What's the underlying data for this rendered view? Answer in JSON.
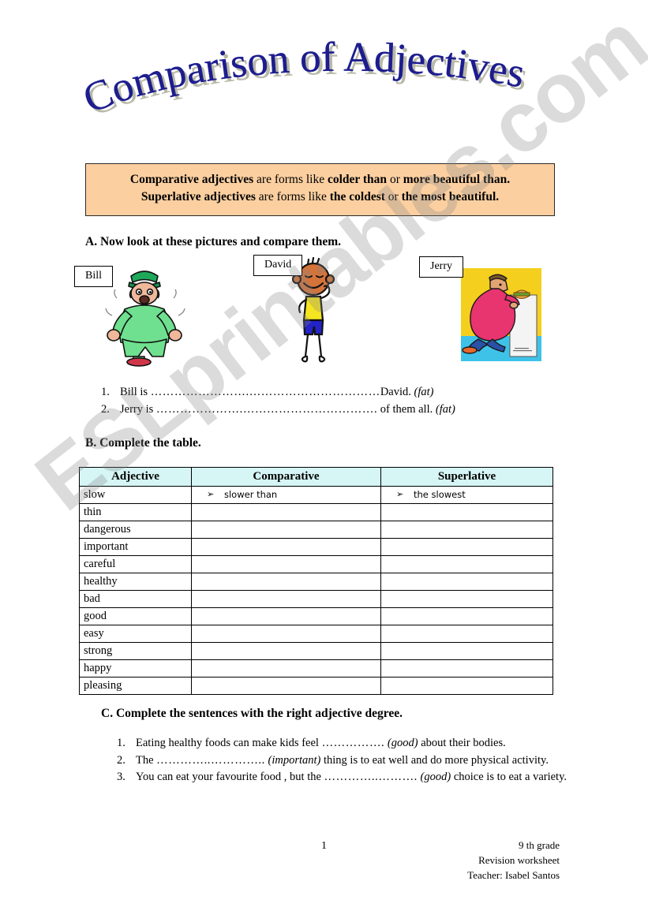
{
  "title": "Comparison of Adjectives",
  "info_box": {
    "line1_parts": [
      {
        "text": "Comparative adjectives",
        "bold": true
      },
      {
        "text": "  are forms like ",
        "bold": false
      },
      {
        "text": "colder than",
        "bold": true
      },
      {
        "text": " or ",
        "bold": false
      },
      {
        "text": "more beautiful than.",
        "bold": true
      }
    ],
    "line2_parts": [
      {
        "text": "Superlative adjectives",
        "bold": true
      },
      {
        "text": " are forms like ",
        "bold": false
      },
      {
        "text": "the coldest",
        "bold": true
      },
      {
        "text": " or ",
        "bold": false
      },
      {
        "text": "the most beautiful.",
        "bold": true
      }
    ],
    "background_color": "#fbcfa0"
  },
  "section_a": {
    "heading": "A. Now look at these pictures and compare them.",
    "pictures": [
      {
        "name_tag": "Bill",
        "description": "heavy man jogging in green tracksuit"
      },
      {
        "name_tag": "David",
        "description": "thin stick figure boy in yellow shirt"
      },
      {
        "name_tag": "Jerry",
        "description": "very large man eating at counter"
      }
    ],
    "exercises": [
      {
        "number": "1.",
        "before": "Bill is ",
        "dots": "…………………….……………………………",
        "after": "David.",
        "hint": "(fat)"
      },
      {
        "number": "2.",
        "before": "Jerry is ",
        "dots": "………………….…………………………….",
        "after": " of them all.",
        "hint": "(fat)"
      }
    ]
  },
  "section_b": {
    "heading": "B. Complete the table.",
    "table": {
      "headers": [
        "Adjective",
        "Comparative",
        "Superlative"
      ],
      "header_background": "#d6f5f5",
      "bullet": "➢",
      "rows": [
        {
          "adjective": "slow",
          "comparative": "slower than",
          "superlative": "the slowest"
        },
        {
          "adjective": "thin",
          "comparative": "",
          "superlative": ""
        },
        {
          "adjective": "dangerous",
          "comparative": "",
          "superlative": ""
        },
        {
          "adjective": "important",
          "comparative": "",
          "superlative": ""
        },
        {
          "adjective": "careful",
          "comparative": "",
          "superlative": ""
        },
        {
          "adjective": "healthy",
          "comparative": "",
          "superlative": ""
        },
        {
          "adjective": "bad",
          "comparative": "",
          "superlative": ""
        },
        {
          "adjective": "good",
          "comparative": "",
          "superlative": ""
        },
        {
          "adjective": "easy",
          "comparative": "",
          "superlative": ""
        },
        {
          "adjective": "strong",
          "comparative": "",
          "superlative": ""
        },
        {
          "adjective": "happy",
          "comparative": "",
          "superlative": ""
        },
        {
          "adjective": "pleasing",
          "comparative": "",
          "superlative": ""
        }
      ]
    }
  },
  "section_c": {
    "heading": "C. Complete the sentences with the right adjective degree.",
    "items": [
      {
        "number": "1.",
        "part1": "Eating healthy foods can make kids feel ",
        "dots": "…………….",
        "hint": "(good)",
        "part2": " about their bodies."
      },
      {
        "number": "2.",
        "part1": "The ",
        "dots": "…………..…………..",
        "hint": "(important)",
        "part2": " thing is to eat well and do more physical activity."
      },
      {
        "number": "3.",
        "part1": "You can eat your favourite food , but the ",
        "dots": "…………..……….",
        "hint": "(good)",
        "part2": " choice is to eat a variety."
      }
    ]
  },
  "footer": {
    "page_number": "1",
    "grade": "9 th grade",
    "worksheet": "Revision worksheet",
    "teacher": "Teacher: Isabel Santos"
  },
  "watermark": {
    "text": "ESLprintables.com"
  }
}
